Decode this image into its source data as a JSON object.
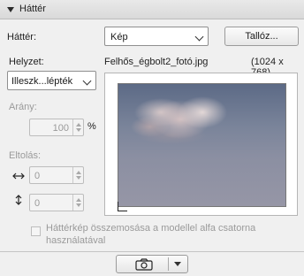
{
  "panel": {
    "title": "Háttér"
  },
  "background": {
    "label": "Háttér:",
    "type_value": "Kép",
    "browse_button": "Tallóz..."
  },
  "position": {
    "label": "Helyzet:",
    "mode_value": "Illeszk...lépték"
  },
  "file": {
    "name": "Felhős_égbolt2_fotó.jpg",
    "dimensions": "(1024 x 768)"
  },
  "ratio": {
    "label": "Arány:",
    "value": "100",
    "unit": "%"
  },
  "offset": {
    "label": "Eltolás:",
    "x_value": "0",
    "y_value": "0"
  },
  "alpha_blend": {
    "label": "Háttérkép összemosása a modellel alfa csatorna használatával",
    "checked": false
  },
  "icons": {
    "collapse": "triangle-down-icon",
    "horizontal_offset": "left-right-arrow-icon",
    "vertical_offset": "up-down-arrow-icon",
    "camera": "camera-icon",
    "dropdown": "chevron-down-icon"
  }
}
